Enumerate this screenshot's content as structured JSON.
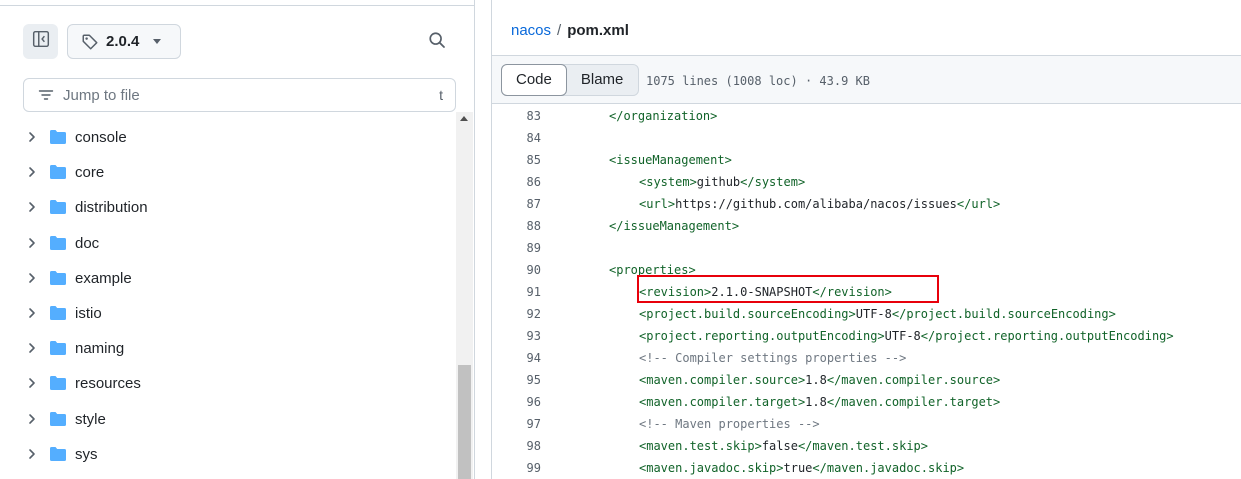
{
  "sidebar": {
    "branch": "2.0.4",
    "jump_placeholder": "Jump to file",
    "jump_shortcut": "t",
    "folders": [
      {
        "name": "console"
      },
      {
        "name": "core"
      },
      {
        "name": "distribution"
      },
      {
        "name": "doc"
      },
      {
        "name": "example"
      },
      {
        "name": "istio"
      },
      {
        "name": "naming"
      },
      {
        "name": "resources"
      },
      {
        "name": "style"
      },
      {
        "name": "sys"
      }
    ]
  },
  "breadcrumb": {
    "repo": "nacos",
    "separator": "/",
    "file": "pom.xml"
  },
  "toolbar": {
    "code_label": "Code",
    "blame_label": "Blame",
    "meta": "1075 lines (1008 loc) · 43.9 KB"
  },
  "code_lines": [
    {
      "n": "83",
      "indent": 1,
      "parts": [
        [
          "t",
          "</organization>"
        ]
      ]
    },
    {
      "n": "84",
      "indent": 0,
      "parts": []
    },
    {
      "n": "85",
      "indent": 1,
      "parts": [
        [
          "t",
          "<issueManagement>"
        ]
      ]
    },
    {
      "n": "86",
      "indent": 2,
      "parts": [
        [
          "t",
          "<system>"
        ],
        [
          "x",
          "github"
        ],
        [
          "t",
          "</system>"
        ]
      ]
    },
    {
      "n": "87",
      "indent": 2,
      "parts": [
        [
          "t",
          "<url>"
        ],
        [
          "x",
          "https://github.com/alibaba/nacos/issues"
        ],
        [
          "t",
          "</url>"
        ]
      ]
    },
    {
      "n": "88",
      "indent": 1,
      "parts": [
        [
          "t",
          "</issueManagement>"
        ]
      ]
    },
    {
      "n": "89",
      "indent": 0,
      "parts": []
    },
    {
      "n": "90",
      "indent": 1,
      "parts": [
        [
          "t",
          "<properties>"
        ]
      ]
    },
    {
      "n": "91",
      "indent": 2,
      "parts": [
        [
          "t",
          "<revision>"
        ],
        [
          "x",
          "2.1.0-SNAPSHOT"
        ],
        [
          "t",
          "</revision>"
        ]
      ]
    },
    {
      "n": "92",
      "indent": 2,
      "parts": [
        [
          "t",
          "<project.build.sourceEncoding>"
        ],
        [
          "x",
          "UTF-8"
        ],
        [
          "t",
          "</project.build.sourceEncoding>"
        ]
      ]
    },
    {
      "n": "93",
      "indent": 2,
      "parts": [
        [
          "t",
          "<project.reporting.outputEncoding>"
        ],
        [
          "x",
          "UTF-8"
        ],
        [
          "t",
          "</project.reporting.outputEncoding>"
        ]
      ]
    },
    {
      "n": "94",
      "indent": 2,
      "parts": [
        [
          "c",
          "<!-- Compiler settings properties -->"
        ]
      ]
    },
    {
      "n": "95",
      "indent": 2,
      "parts": [
        [
          "t",
          "<maven.compiler.source>"
        ],
        [
          "x",
          "1.8"
        ],
        [
          "t",
          "</maven.compiler.source>"
        ]
      ]
    },
    {
      "n": "96",
      "indent": 2,
      "parts": [
        [
          "t",
          "<maven.compiler.target>"
        ],
        [
          "x",
          "1.8"
        ],
        [
          "t",
          "</maven.compiler.target>"
        ]
      ]
    },
    {
      "n": "97",
      "indent": 2,
      "parts": [
        [
          "c",
          "<!-- Maven properties -->"
        ]
      ]
    },
    {
      "n": "98",
      "indent": 2,
      "parts": [
        [
          "t",
          "<maven.test.skip>"
        ],
        [
          "x",
          "false"
        ],
        [
          "t",
          "</maven.test.skip>"
        ]
      ]
    },
    {
      "n": "99",
      "indent": 2,
      "parts": [
        [
          "t",
          "<maven.javadoc.skip>"
        ],
        [
          "x",
          "true"
        ],
        [
          "t",
          "</maven.javadoc.skip>"
        ]
      ]
    }
  ],
  "colors": {
    "link": "#0969da",
    "xml_tag": "#116329",
    "comment": "#6e7781",
    "highlight_border": "#e8000b",
    "folder": "#54aeff"
  },
  "icons": {
    "panel_toggle": "sidebar-collapse-icon",
    "branch": "tag-icon",
    "search": "search-icon",
    "filter": "filter-icon",
    "folder": "folder-icon",
    "chevron": "chevron-right-icon"
  }
}
